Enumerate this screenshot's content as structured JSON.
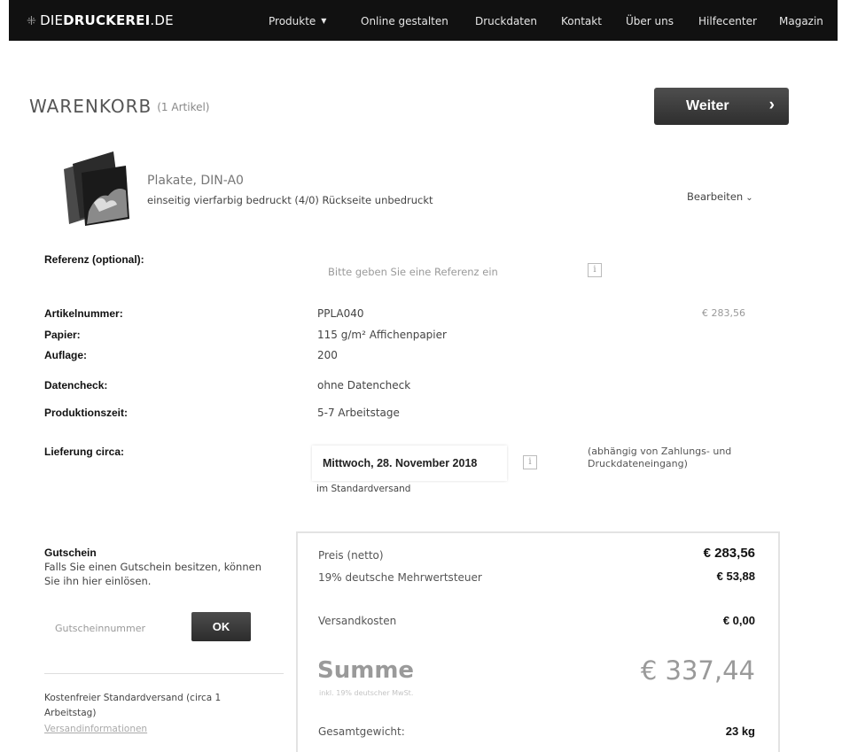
{
  "nav": {
    "logo_prefix": "DIE",
    "logo_bold": "DRUCKEREI",
    "logo_suffix": ".DE",
    "items": [
      "Produkte",
      "Online gestalten",
      "Druckdaten",
      "Kontakt",
      "Über uns",
      "Hilfecenter",
      "Magazin"
    ]
  },
  "cart": {
    "title": "WARENKORB",
    "count": "(1 Artikel)",
    "next_button": "Weiter"
  },
  "product": {
    "name": "Plakate, DIN-A0",
    "description": "einseitig vierfarbig bedruckt (4/0) Rückseite unbedruckt",
    "edit_label": "Bearbeiten",
    "price": "€ 283,56"
  },
  "reference": {
    "label": "Referenz (optional):",
    "placeholder": "Bitte geben Sie eine Referenz ein",
    "value": ""
  },
  "details": {
    "artikelnummer_label": "Artikelnummer:",
    "artikelnummer": "PPLA040",
    "papier_label": "Papier:",
    "papier": "115 g/m² Affichenpapier",
    "auflage_label": "Auflage:",
    "auflage": "200",
    "datencheck_label": "Datencheck:",
    "datencheck": "ohne Datencheck",
    "produktionszeit_label": "Produktionszeit:",
    "produktionszeit": "5-7 Arbeitstage"
  },
  "delivery": {
    "label": "Lieferung circa:",
    "date": "Mittwoch, 28. November 2018",
    "note": "(abhängig von Zahlungs- und Druckdateneingang)",
    "method": "im Standardversand"
  },
  "voucher": {
    "title": "Gutschein",
    "text": "Falls Sie einen Gutschein besitzen, können Sie ihn hier einlösen.",
    "placeholder": "Gutscheinnummer",
    "value": "",
    "ok_label": "OK"
  },
  "shipping": {
    "text": "Kostenfreier Standardversand (circa 1 Arbeitstag)",
    "link": "Versandinformationen"
  },
  "summary": {
    "net_label": "Preis (netto)",
    "net": "€ 283,56",
    "vat_label": "19% deutsche Mehrwertsteuer",
    "vat": "€ 53,88",
    "shipping_label": "Versandkosten",
    "shipping": "€ 0,00",
    "sum_label": "Summe",
    "sum_sub": "inkl. 19% deutscher MwSt.",
    "total": "€ 337,44",
    "weight_label": "Gesamtgewicht:",
    "weight": "23 kg"
  },
  "icons": {
    "info": "info-icon",
    "chevron_right": "chevron-right-icon",
    "chevron_down": "chevron-down-icon"
  }
}
